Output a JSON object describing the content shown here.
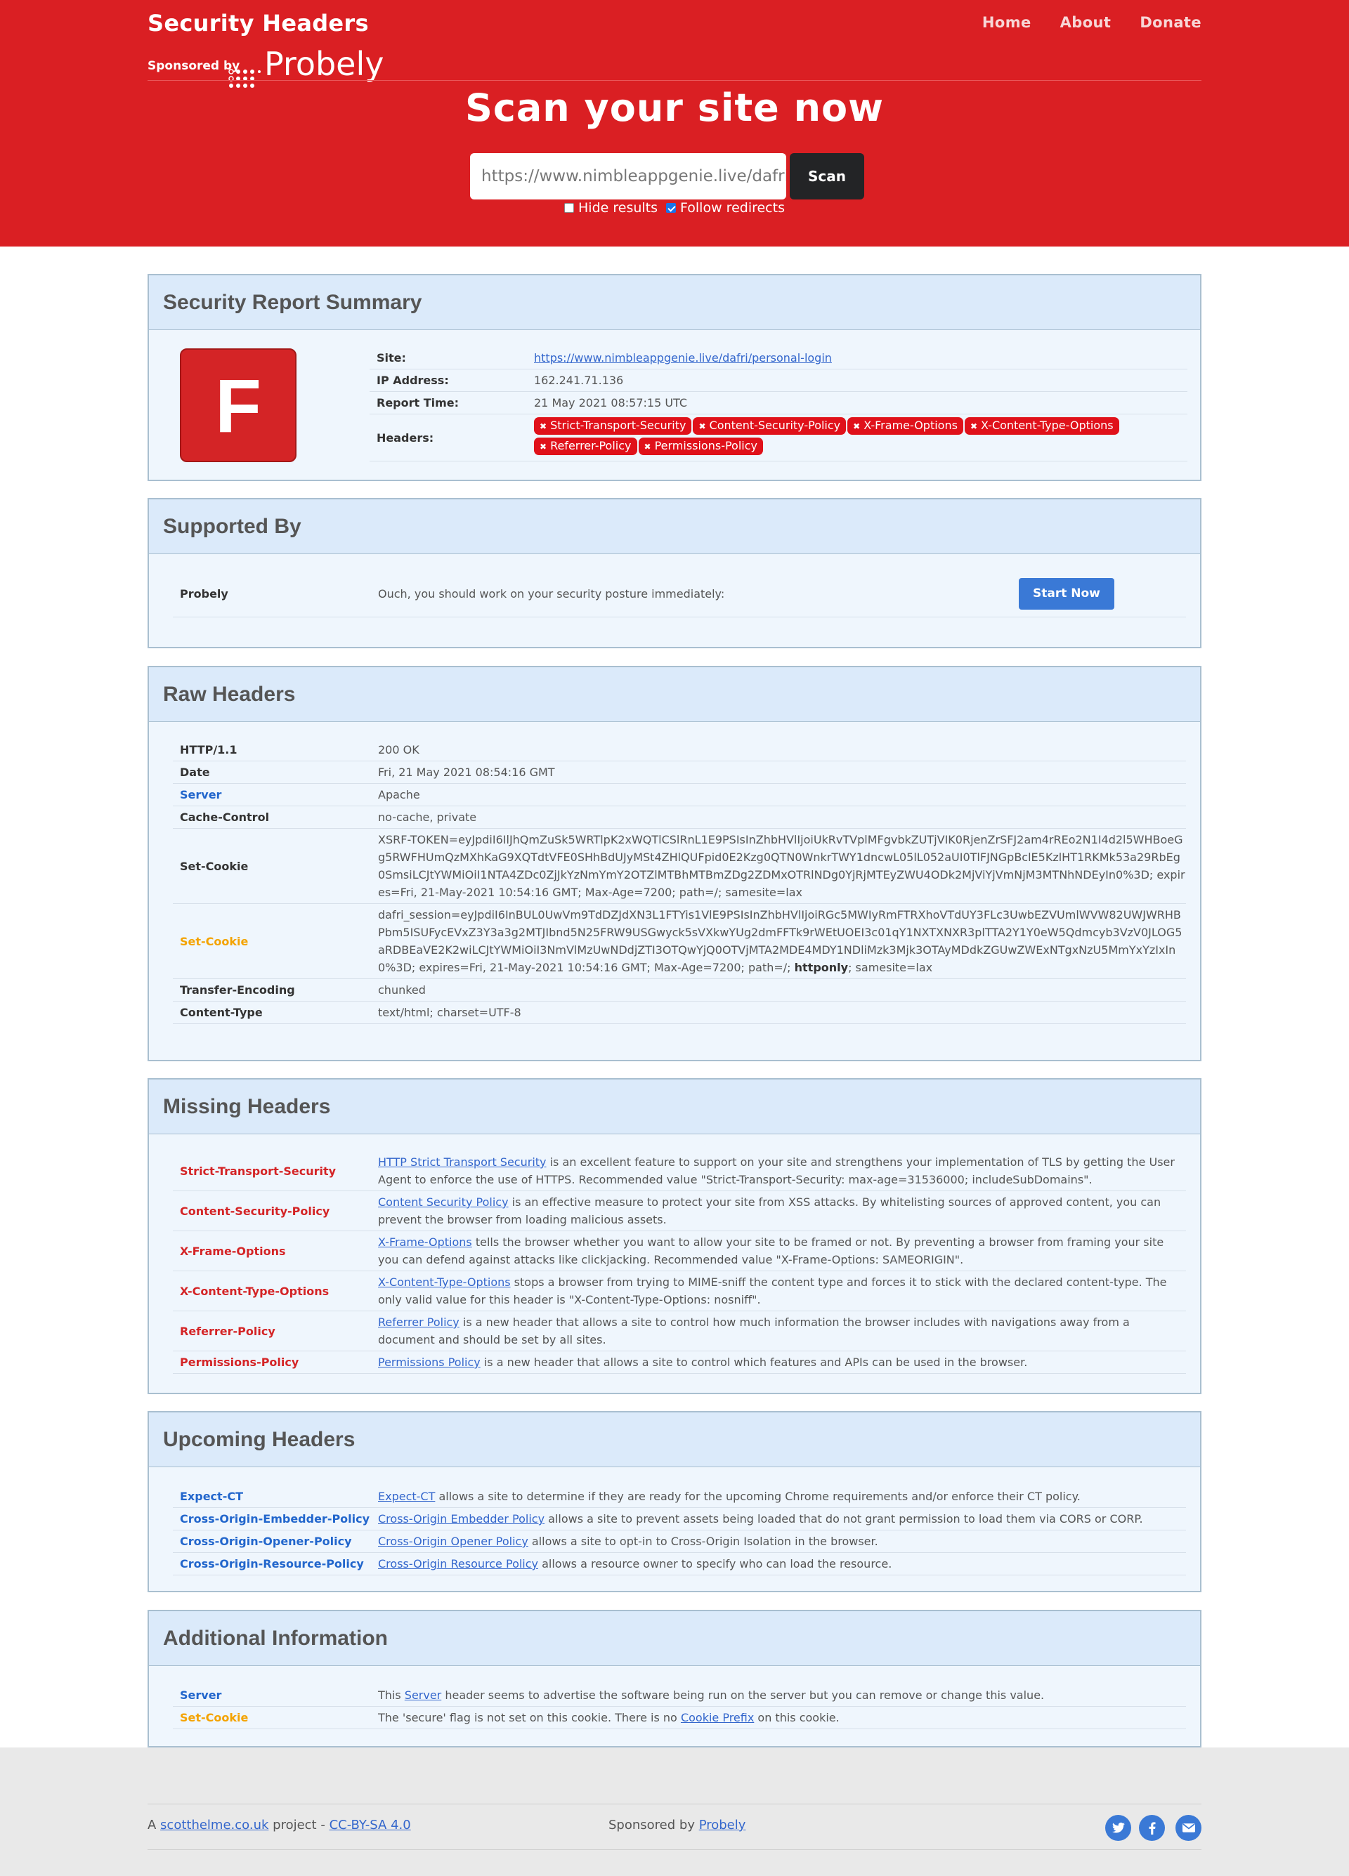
{
  "brand": {
    "title": "Security Headers",
    "sponsored_by": "Sponsored by",
    "sponsor_name": "Probely"
  },
  "nav": [
    "Home",
    "About",
    "Donate"
  ],
  "hero": {
    "title": "Scan your site now",
    "url_value": "https://www.nimbleappgenie.live/dafri/personal-login",
    "scan_label": "Scan",
    "hide_results": "Hide results",
    "follow_redirects": "Follow redirects",
    "hide_checked": false,
    "follow_checked": true
  },
  "summary": {
    "title": "Security Report Summary",
    "grade": "F",
    "site_label": "Site:",
    "site_value": "https://www.nimbleappgenie.live/dafri/personal-login",
    "ip_label": "IP Address:",
    "ip_value": "162.241.71.136",
    "time_label": "Report Time:",
    "time_value": "21 May 2021 08:57:15 UTC",
    "headers_label": "Headers:",
    "missing": [
      "Strict-Transport-Security",
      "Content-Security-Policy",
      "X-Frame-Options",
      "X-Content-Type-Options",
      "Referrer-Policy",
      "Permissions-Policy"
    ],
    "missing_color": "#e0111a"
  },
  "supported": {
    "title": "Supported By",
    "name": "Probely",
    "text": "Ouch, you should work on your security posture immediately:",
    "button": "Start Now"
  },
  "raw": {
    "title": "Raw Headers",
    "rows": [
      {
        "k": "HTTP/1.1",
        "v": "200 OK",
        "c": ""
      },
      {
        "k": "Date",
        "v": "Fri, 21 May 2021 08:54:16 GMT",
        "c": ""
      },
      {
        "k": "Server",
        "v": "Apache",
        "c": "blue"
      },
      {
        "k": "Cache-Control",
        "v": "no-cache, private",
        "c": ""
      },
      {
        "k": "Set-Cookie",
        "v": "XSRF-TOKEN=eyJpdiI6IlJhQmZuSk5WRTlpK2xWQTlCSlRnL1E9PSIsInZhbHVlIjoiUkRvTVplMFgvbkZUTjVIK0RjenZrSFJ2am4rREo2N1I4d2l5WHBoeGg5RWFHUmQzMXhKaG9XQTdtVFE0SHhBdUJyMSt4ZHlQUFpid0E2Kzg0QTN0WnkrTWY1dncwL05lL052aUI0TlFJNGpBclE5KzlHT1RKMk53a29RbEg0SmsiLCJtYWMiOiI1NTA4ZDc0ZjJkYzNmYmY2OTZlMTBhMTBmZDg2ZDMxOTRlNDg0YjRjMTEyZWU4ODk2MjViYjVmNjM3MTNhNDEyIn0%3D; expires=Fri, 21-May-2021 10:54:16 GMT; Max-Age=7200; path=/; samesite=lax",
        "c": ""
      },
      {
        "k": "Set-Cookie",
        "v": "dafri_session=eyJpdiI6InBUL0UwVm9TdDZJdXN3L1FTYis1VlE9PSIsInZhbHVlIjoiRGc5MWIyRmFTRXhoVTdUY3FLc3UwbEZVUmlWVW82UWJWRHBPbm5ISUFycEVxZ3Y3a3g2MTJIbnd5N25FRW9USGwyck5sVXkwYUg2dmFFTk9rWEtUOEI3c01qY1NXTXNXR3plTTA2Y1Y0eW5Qdmcyb3VzV0JLOG5aRDBEaVE2K2wiLCJtYWMiOiI3NmVlMzUwNDdjZTI3OTQwYjQ0OTVjMTA2MDE4MDY1NDliMzk3Mjk3OTAyMDdkZGUwZWExNTgxNzU5MmYxYzIxIn0%3D; expires=Fri, 21-May-2021 10:54:16 GMT; Max-Age=7200; path=/; ",
        "bold": "httponly",
        "tail": "; samesite=lax",
        "c": "orange"
      },
      {
        "k": "Transfer-Encoding",
        "v": "chunked",
        "c": ""
      },
      {
        "k": "Content-Type",
        "v": "text/html; charset=UTF-8",
        "c": ""
      }
    ]
  },
  "missing": {
    "title": "Missing Headers",
    "rows": [
      {
        "k": "Strict-Transport-Security",
        "link": "HTTP Strict Transport Security",
        "text": " is an excellent feature to support on your site and strengthens your implementation of TLS by getting the User Agent to enforce the use of HTTPS. Recommended value \"Strict-Transport-Security: max-age=31536000; includeSubDomains\"."
      },
      {
        "k": "Content-Security-Policy",
        "link": "Content Security Policy",
        "text": " is an effective measure to protect your site from XSS attacks. By whitelisting sources of approved content, you can prevent the browser from loading malicious assets."
      },
      {
        "k": "X-Frame-Options",
        "link": "X-Frame-Options",
        "text": " tells the browser whether you want to allow your site to be framed or not. By preventing a browser from framing your site you can defend against attacks like clickjacking. Recommended value \"X-Frame-Options: SAMEORIGIN\"."
      },
      {
        "k": "X-Content-Type-Options",
        "link": "X-Content-Type-Options",
        "text": " stops a browser from trying to MIME-sniff the content type and forces it to stick with the declared content-type. The only valid value for this header is \"X-Content-Type-Options: nosniff\"."
      },
      {
        "k": "Referrer-Policy",
        "link": "Referrer Policy",
        "text": " is a new header that allows a site to control how much information the browser includes with navigations away from a document and should be set by all sites."
      },
      {
        "k": "Permissions-Policy",
        "link": "Permissions Policy",
        "text": " is a new header that allows a site to control which features and APIs can be used in the browser."
      }
    ]
  },
  "upcoming": {
    "title": "Upcoming Headers",
    "rows": [
      {
        "k": "Expect-CT",
        "link": "Expect-CT",
        "text": " allows a site to determine if they are ready for the upcoming Chrome requirements and/or enforce their CT policy."
      },
      {
        "k": "Cross-Origin-Embedder-Policy",
        "link": "Cross-Origin Embedder Policy",
        "text": " allows a site to prevent assets being loaded that do not grant permission to load them via CORS or CORP."
      },
      {
        "k": "Cross-Origin-Opener-Policy",
        "link": "Cross-Origin Opener Policy",
        "text": " allows a site to opt-in to Cross-Origin Isolation in the browser."
      },
      {
        "k": "Cross-Origin-Resource-Policy",
        "link": "Cross-Origin Resource Policy",
        "text": " allows a resource owner to specify who can load the resource."
      }
    ]
  },
  "additional": {
    "title": "Additional Information",
    "rows": [
      {
        "k": "Server",
        "pre": "This ",
        "link": "Server",
        "text": " header seems to advertise the software being run on the server but you can remove or change this value.",
        "c": "blue"
      },
      {
        "k": "Set-Cookie",
        "pre": "The 'secure' flag is not set on this cookie. There is no ",
        "link": "Cookie Prefix",
        "text": " on this cookie.",
        "c": "orange"
      }
    ]
  },
  "footer": {
    "a": "A ",
    "site": "scotthelme.co.uk",
    "project": " project - ",
    "license": "CC-BY-SA 4.0",
    "sponsored": "Sponsored by ",
    "sponsor": "Probely",
    "social": [
      "twitter-icon",
      "facebook-icon",
      "email-icon"
    ]
  }
}
